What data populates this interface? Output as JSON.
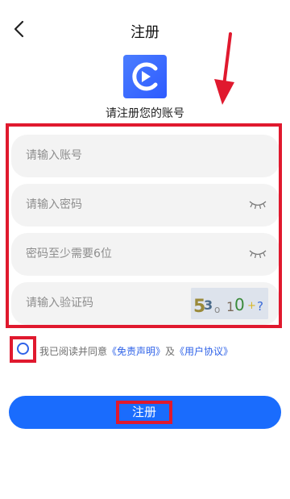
{
  "header": {
    "title": "注册",
    "back_icon": "chevron-left-icon"
  },
  "logo": {
    "icon": "play-icon",
    "color": "#2e5bff"
  },
  "subtitle": "请注册您的账号",
  "form": {
    "account_placeholder": "请输入账号",
    "password_placeholder": "请输入密码",
    "confirm_placeholder": "密码至少需要6位",
    "code_placeholder": "请输入验证码",
    "eye_icon": "eye-closed-icon",
    "captcha_chars": [
      "5",
      "3",
      "o",
      "1",
      "0",
      "+",
      "?"
    ]
  },
  "agreement": {
    "prefix": "我已阅读并同意",
    "disclaimer_link": "《免责声明》",
    "and_text": "及",
    "terms_link": "《用户协议》"
  },
  "register_button": {
    "label": "注册"
  },
  "colors": {
    "accent": "#1a6cfd",
    "link": "#2e62e8",
    "highlight": "#e0192e",
    "field_bg": "#f3f3f3",
    "placeholder": "#8e8e8e"
  }
}
